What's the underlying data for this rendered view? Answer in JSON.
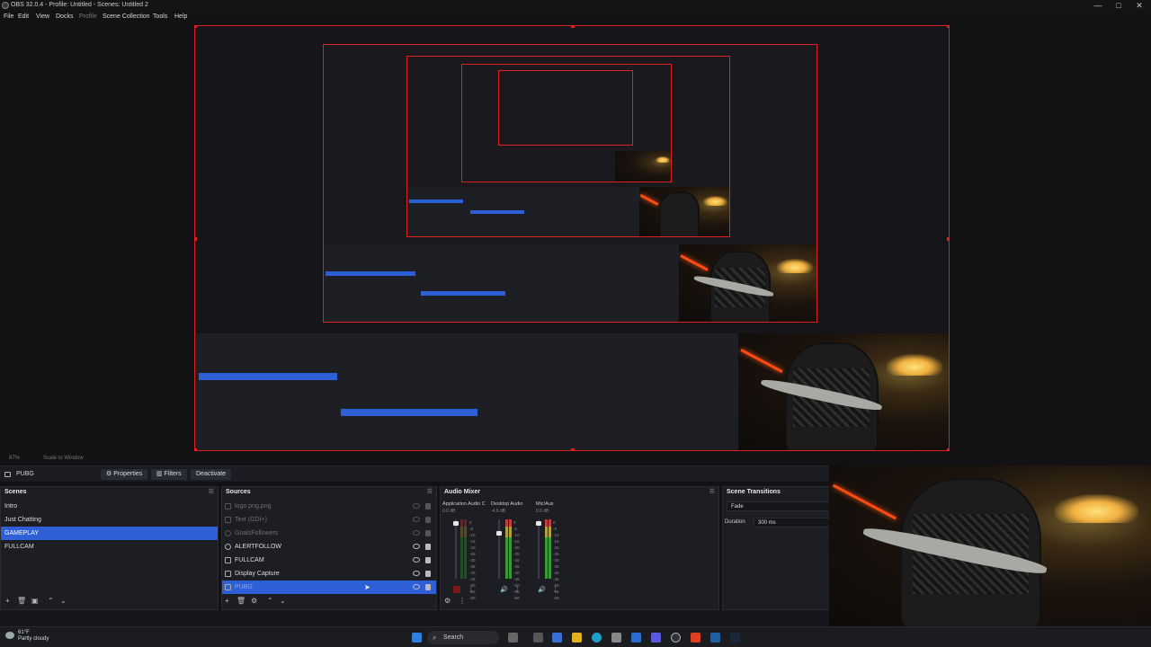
{
  "window": {
    "title": "OBS 32.0.4 - Profile: Untitled - Scenes: Untitled 2",
    "controls": [
      "—",
      "□",
      "✕"
    ]
  },
  "menu": [
    {
      "label": "File",
      "dim": false
    },
    {
      "label": "Edit",
      "dim": false
    },
    {
      "label": "View",
      "dim": false
    },
    {
      "label": "Docks",
      "dim": false
    },
    {
      "label": "Profile",
      "dim": true
    },
    {
      "label": "Scene Collection",
      "dim": false
    },
    {
      "label": "Tools",
      "dim": false
    },
    {
      "label": "Help",
      "dim": false
    }
  ],
  "preview": {
    "zoom": "87%",
    "scale_mode": "Scale to Window"
  },
  "context_bar": {
    "source": "PUBG",
    "properties": "Properties",
    "filters": "Filters",
    "deactivate": "Deactivate"
  },
  "scenes": {
    "title": "Scenes",
    "items": [
      "Intro",
      "Just Chatting",
      "GAMEPLAY",
      "FULLCAM"
    ],
    "selected": 2
  },
  "sources": {
    "title": "Sources",
    "items": [
      {
        "label": "logo png.png",
        "dim": true
      },
      {
        "label": "Text (GDI+)",
        "dim": true
      },
      {
        "label": "GoalsFollowers",
        "dim": true
      },
      {
        "label": "ALERTFOLLOW",
        "dim": false
      },
      {
        "label": "FULLCAM",
        "dim": false
      },
      {
        "label": "Display Capture",
        "dim": false
      },
      {
        "label": "PUBG",
        "dim": true,
        "selected": true
      }
    ]
  },
  "mixer": {
    "title": "Audio Mixer",
    "channels": [
      {
        "name": "Application Audio C",
        "db": "0.0 dB",
        "level": 0.9
      },
      {
        "name": "Desktop Audio",
        "db": "-4.6 dB",
        "level": 0.75
      },
      {
        "name": "Mic/Aux",
        "db": "0.0 dB",
        "level": 0.9
      }
    ],
    "scale": [
      "0",
      "-5",
      "-10",
      "-15",
      "-20",
      "-25",
      "-30",
      "-35",
      "-40",
      "-45",
      "-50",
      "-55",
      "-60"
    ]
  },
  "transitions": {
    "title": "Scene Transitions",
    "type": "Fade",
    "duration_label": "Duration",
    "duration": "300 ms"
  },
  "taskbar": {
    "temp": "61°F",
    "weather": "Partly cloudy",
    "search": "Search"
  },
  "colors": {
    "accent": "#2f5fd6",
    "selection_border": "#e02020",
    "bg": "#121214",
    "dock": "#1d1e23"
  }
}
